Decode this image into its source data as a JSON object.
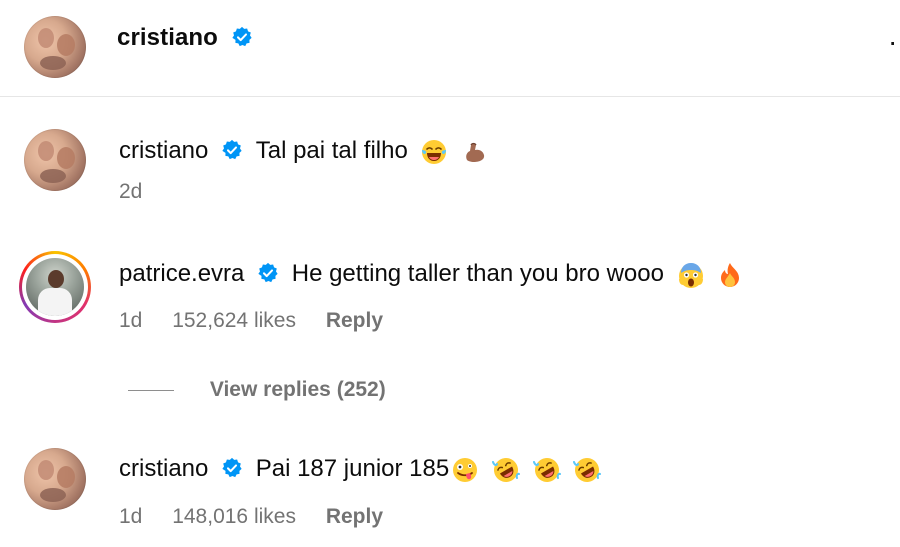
{
  "header": {
    "username": "cristiano",
    "more_label": "·"
  },
  "comments": [
    {
      "username": "cristiano",
      "text": "Tal pai tal filho",
      "emojis": [
        "laughing-tears-emoji",
        "flexed-biceps-emoji"
      ],
      "time": "2d"
    },
    {
      "username": "patrice.evra",
      "text": "He getting taller than you bro wooo",
      "emojis": [
        "screaming-face-emoji",
        "fire-emoji"
      ],
      "time": "1d",
      "likes": "152,624 likes",
      "reply_label": "Reply",
      "view_replies": "View replies (252)"
    },
    {
      "username": "cristiano",
      "text": "Pai 187 junior 185",
      "emojis": [
        "zany-face-emoji",
        "rofl-emoji",
        "rofl-emoji",
        "rofl-emoji"
      ],
      "time": "1d",
      "likes": "148,016 likes",
      "reply_label": "Reply"
    }
  ],
  "colors": {
    "verified": "#0095f6",
    "meta_text": "#737373",
    "story_ring": [
      "#f9c400",
      "#ff7a00",
      "#e1306c",
      "#c13584",
      "#833ab4"
    ]
  }
}
